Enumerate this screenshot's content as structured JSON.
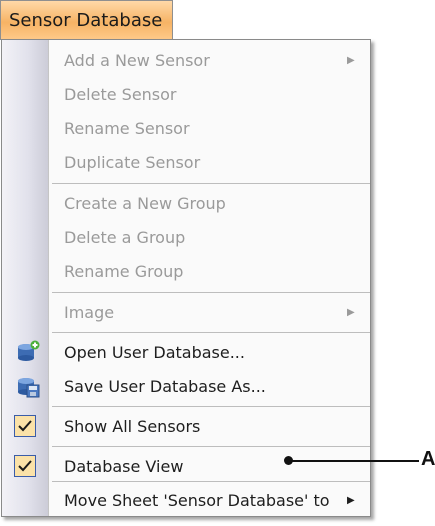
{
  "menu": {
    "title": "Sensor Database",
    "items": [
      {
        "label": "Add a New Sensor",
        "disabled": true,
        "submenu": true
      },
      {
        "label": "Delete Sensor",
        "disabled": true
      },
      {
        "label": "Rename Sensor",
        "disabled": true
      },
      {
        "label": "Duplicate Sensor",
        "disabled": true
      },
      {
        "label": "Create a New Group",
        "disabled": true
      },
      {
        "label": "Delete a Group",
        "disabled": true
      },
      {
        "label": "Rename Group",
        "disabled": true
      },
      {
        "label": "Image",
        "disabled": true,
        "submenu": true
      },
      {
        "label": "Open User Database...",
        "icon": "open-database-icon"
      },
      {
        "label": "Save User Database As...",
        "icon": "save-database-icon"
      },
      {
        "label": "Show All Sensors",
        "checked": true
      },
      {
        "label": "Database View",
        "checked": true
      },
      {
        "label": "Move Sheet 'Sensor Database' to",
        "submenu": true
      }
    ]
  },
  "callout": {
    "label": "A"
  },
  "colors": {
    "tab": "#f6b365",
    "check_bg": "#fbe2a8",
    "check_border": "#3a5ca8",
    "disabled_text": "#9a9a9a"
  }
}
